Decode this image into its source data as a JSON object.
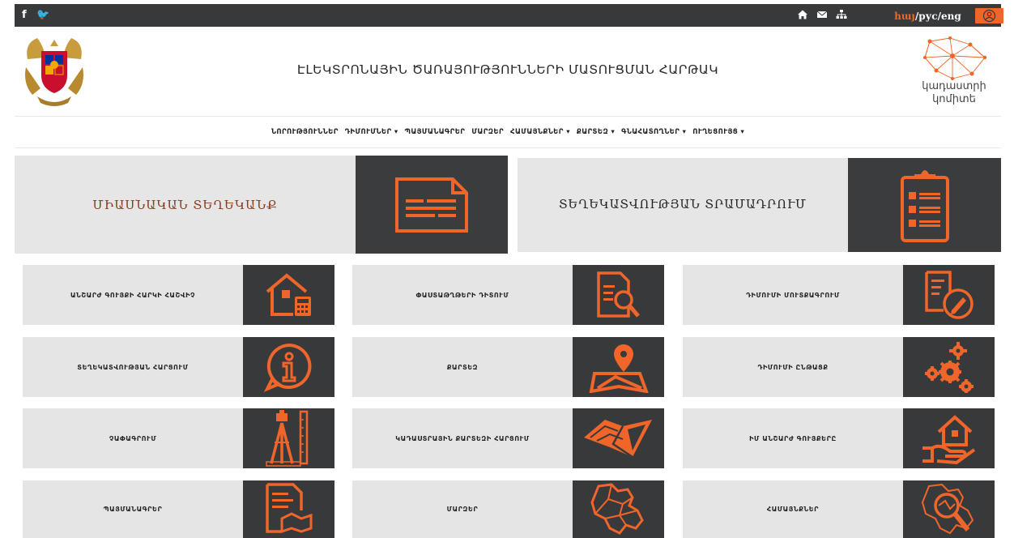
{
  "topbar": {
    "social": "f 🐦",
    "lang": {
      "hy": "հայ",
      "rest": "/рус/eng"
    }
  },
  "header": {
    "title": "ԷԼԵԿՏՐՈՆԱՅԻՆ ԾԱՌԱՅՈՒԹՅՈՒՆՆԵՐԻ ՄԱՏՈՒՑՄԱՆ ՀԱՐԹԱԿ",
    "logo_text_1": "կադաստրի",
    "logo_text_2": "կոմիտե"
  },
  "nav": [
    "ՆՈՐՈՒԹՅՈՒՆՆԵՐ",
    "ԴԻՄՈՒՄՆԵՐ ▾",
    "ՊԱՅՄԱՆԱԳՐԵՐ",
    "ՄԱՐԶԵՐ",
    "ՀԱՄԱՅՆՔՆԵՐ ▾",
    "ՔԱՐՏԵԶ ▾",
    "ԳՆԱՀԱՏՈՂՆԵՐ ▾",
    "ՈՒՂԵՑՈՒՅՑ ▾"
  ],
  "big": {
    "left": "ՄԻԱՍՆԱԿԱՆ ՏԵՂԵԿԱՆՔ",
    "right": "ՏԵՂԵԿԱՏՎՈՒԹՅԱՆ ՏՐԱՄԱԴՐՈՒՄ"
  },
  "tiles": [
    "ԱՆՇԱՐԺ ԳՈՒՅՔԻ ՀԱՐԿԻ ՀԱՇՎԻՉ",
    "ՓԱՍՏԱԹՂԹԵՐԻ ԴԻՏՈՒՄ",
    "ԴԻՄՈՒՄԻ ՄՈՒՏՔԱԳՐՈՒՄ",
    "ՏԵՂԵԿԱՏՎՈՒԹՅԱՆ ՀԱՐՑՈՒՄ",
    "ՔԱՐՏԵԶ",
    "ԴԻՄՈՒՄԻ ԸՆԹԱՑՔ",
    "ՉԱՓԱԳՐՈՒՄ",
    "ԿԱԴԱՍՏՐԱՅԻՆ ՔԱՐՏԵԶԻ ՀԱՐՑՈՒՄ",
    "ԻՄ ԱՆՇԱՐԺ ԳՈՒՅՔԵՐԸ",
    "ՊԱՅՄԱՆԱԳՐԵՐ",
    "ՄԱՐԶԵՐ",
    "ՀԱՄԱՅՆՔՆԵՐ"
  ],
  "colors": {
    "accent": "#f0652a",
    "dark": "#38393b",
    "tile_bg": "#e5e5e6",
    "big_text_left": "#8a3a1a"
  }
}
